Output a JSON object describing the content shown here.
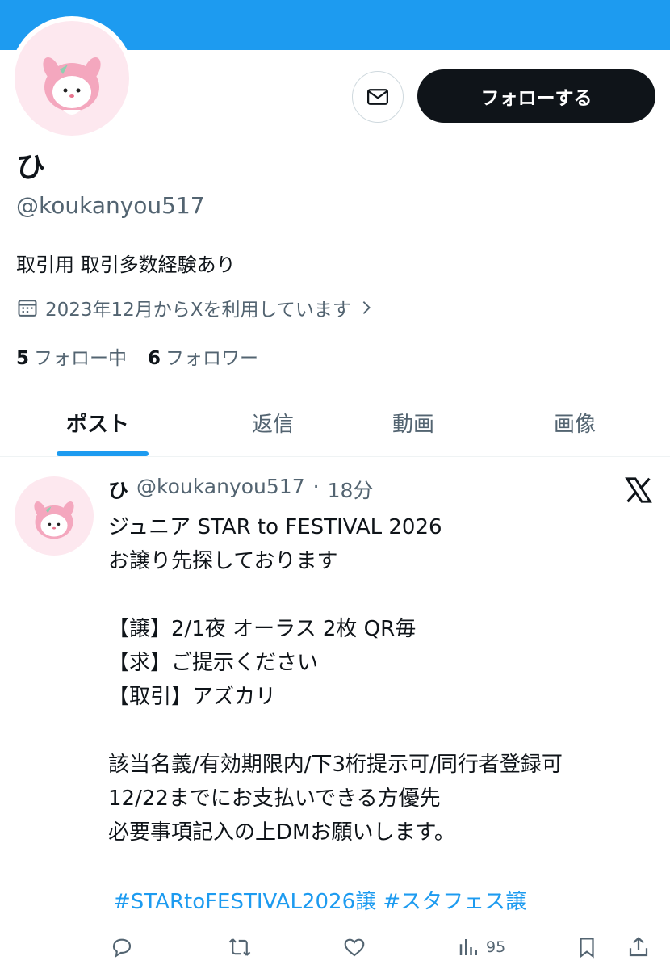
{
  "colors": {
    "banner": "#1d9bf0",
    "accent": "#1d9bf0",
    "text": "#0f1419",
    "muted": "#536471"
  },
  "profile": {
    "name": "ひ",
    "handle": "@koukanyou517",
    "bio": "取引用 取引多数経験あり",
    "joined": "2023年12月からXを利用しています",
    "following_count": "5",
    "following_label": "フォロー中",
    "followers_count": "6",
    "followers_label": "フォロワー",
    "follow_button": "フォローする"
  },
  "tabs": [
    "ポスト",
    "返信",
    "動画",
    "画像"
  ],
  "post": {
    "name": "ひ",
    "handle": "@koukanyou517",
    "separator": "·",
    "time": "18分",
    "body": "ジュニア STAR to FESTIVAL 2026\nお譲り先探しております\n\n【譲】2/1夜 オーラス 2枚 QR毎\n【求】ご提示ください\n【取引】アズカリ\n\n該当名義/有効期限内/下3桁提示可/同行者登録可\n12/22までにお支払いできる方優先\n必要事項記入の上DMお願いします。",
    "hashtags": "#STARtoFESTIVAL2026譲 #スタフェス譲",
    "views": "95"
  },
  "icons": {
    "message": "envelope-icon",
    "calendar": "calendar-icon",
    "chevron": "chevron-right-icon",
    "x_logo": "x-logo-icon",
    "reply": "reply-icon",
    "repost": "repost-icon",
    "like": "heart-icon",
    "views": "views-icon",
    "bookmark": "bookmark-icon",
    "share": "share-icon"
  }
}
